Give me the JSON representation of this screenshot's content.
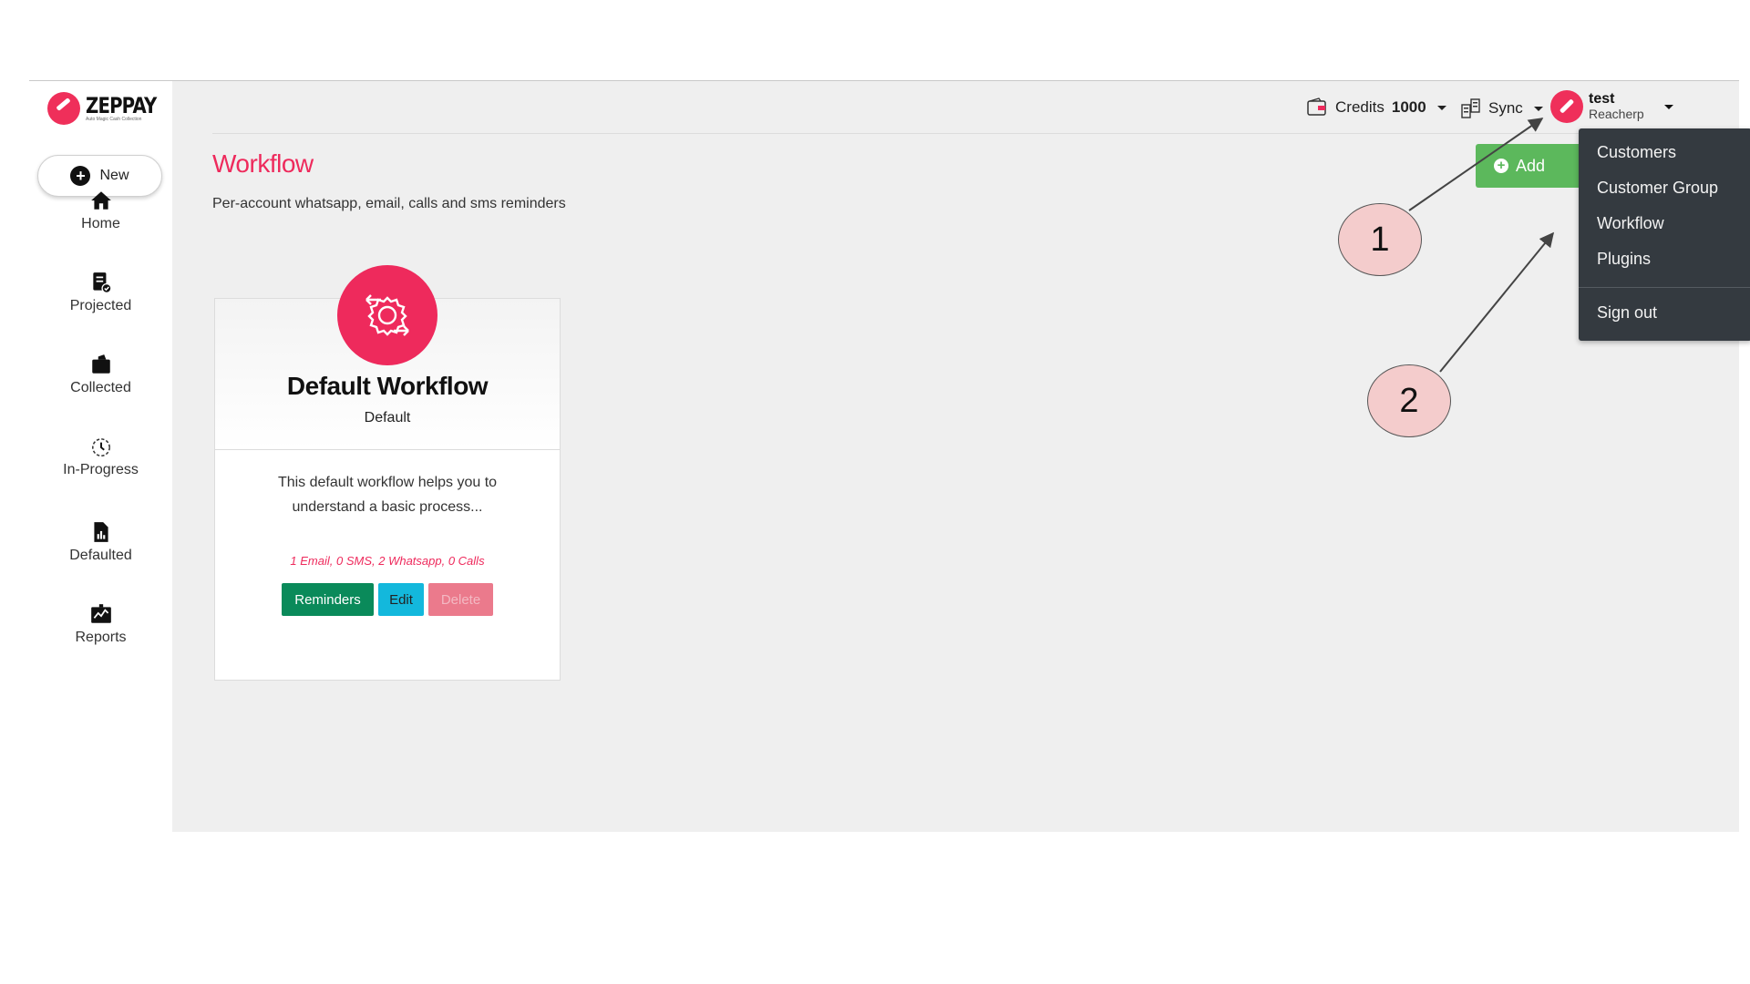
{
  "brand": {
    "name": "ZEPPAY",
    "tagline": "Auto Magic Cash Collection",
    "accent": "#ee2a5c"
  },
  "sidebar": {
    "new_label": "New",
    "items": [
      {
        "label": "Home",
        "icon": "home-icon"
      },
      {
        "label": "Projected",
        "icon": "document-check-icon"
      },
      {
        "label": "Collected",
        "icon": "wallet-icon"
      },
      {
        "label": "In-Progress",
        "icon": "clock-icon"
      },
      {
        "label": "Defaulted",
        "icon": "file-chart-icon"
      },
      {
        "label": "Reports",
        "icon": "chart-board-icon"
      }
    ]
  },
  "header": {
    "credits_label": "Credits",
    "credits_value": "1000",
    "sync_label": "Sync",
    "user_name": "test",
    "user_org": "Reacherp"
  },
  "page": {
    "title": "Workflow",
    "subtitle": "Per-account whatsapp, email, calls and sms reminders",
    "add_label": "Add"
  },
  "workflow_card": {
    "title": "Default Workflow",
    "type": "Default",
    "description": "This default workflow helps you to understand a basic process...",
    "stats": "1 Email, 0 SMS, 2 Whatsapp, 0 Calls",
    "actions": {
      "reminders": "Reminders",
      "edit": "Edit",
      "delete": "Delete"
    }
  },
  "user_menu": {
    "items": [
      "Customers",
      "Customer Group",
      "Workflow",
      "Plugins"
    ],
    "sign_out": "Sign out"
  },
  "annotations": {
    "callout_1": "1",
    "callout_2": "2"
  }
}
